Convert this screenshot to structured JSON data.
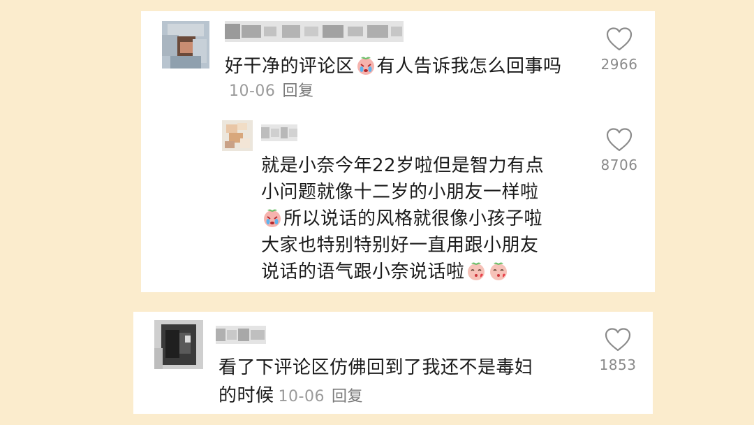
{
  "comments": [
    {
      "text": "好干净的评论区",
      "text_after": "有人告诉我怎么回事吗",
      "date": "10-06",
      "reply_label": "回复",
      "likes": "2966",
      "emoji": "crying-peach-emoji",
      "reply": {
        "line1": "就是小奈今年22岁啦但是智力有点",
        "line2": "小问题就像十二岁的小朋友一样啦",
        "line3": "所以说话的风格就很像小孩子啦",
        "line4": "大家也特别特别好一直用跟小朋友",
        "line5": "说话的语气跟小奈说话啦",
        "likes": "8706",
        "emoji": "kissing-peach-emoji"
      }
    },
    {
      "text_line1": "看了下评论区仿佛回到了我还不是毒妇",
      "text_line2": "的时候",
      "date": "10-06",
      "reply_label": "回复",
      "likes": "1853"
    }
  ],
  "colors": {
    "background": "#fbeccd",
    "card": "#ffffff",
    "text": "#1a1a1a",
    "meta": "#9a9a9a"
  }
}
